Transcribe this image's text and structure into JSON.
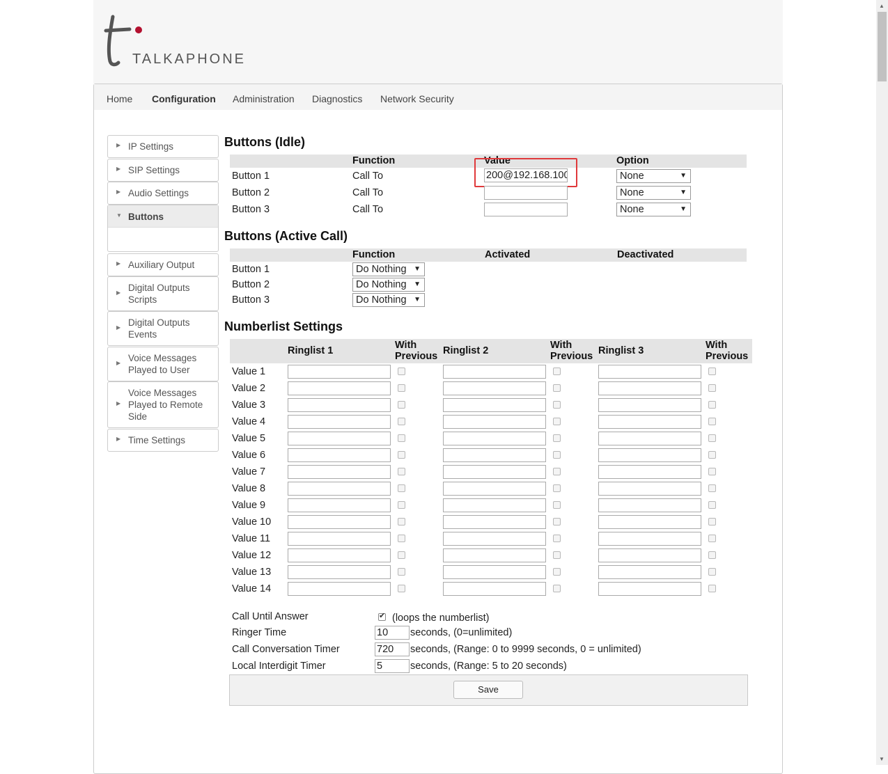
{
  "brand": {
    "name": "TALKAPHONE",
    "accent": "#b3102f"
  },
  "nav": [
    "Home",
    "Configuration",
    "Administration",
    "Diagnostics",
    "Network Security"
  ],
  "sidebar": [
    {
      "label": "IP Settings",
      "icon": "caret-right-icon"
    },
    {
      "label": "SIP Settings",
      "icon": "caret-right-icon"
    },
    {
      "label": "Audio Settings",
      "icon": "caret-right-icon"
    },
    {
      "label": "Buttons",
      "icon": "caret-down-icon",
      "expanded": true
    },
    {
      "label": "Auxiliary Output",
      "icon": "caret-right-icon"
    },
    {
      "label": "Digital Outputs Scripts",
      "icon": "caret-right-icon"
    },
    {
      "label": "Digital Outputs Events",
      "icon": "caret-right-icon"
    },
    {
      "label": "Voice Messages Played to User",
      "icon": "caret-right-icon"
    },
    {
      "label": "Voice Messages Played to Remote Side",
      "icon": "caret-right-icon"
    },
    {
      "label": "Time Settings",
      "icon": "caret-right-icon"
    }
  ],
  "idle": {
    "title": "Buttons (Idle)",
    "headers": [
      "Function",
      "Value",
      "Option"
    ],
    "rows": [
      {
        "label": "Button 1",
        "function": "Call To",
        "value": "200@192.168.100",
        "option": "None"
      },
      {
        "label": "Button 2",
        "function": "Call To",
        "value": "",
        "option": "None"
      },
      {
        "label": "Button 3",
        "function": "Call To",
        "value": "",
        "option": "None"
      }
    ]
  },
  "active": {
    "title": "Buttons (Active Call)",
    "headers": [
      "Function",
      "Activated",
      "Deactivated"
    ],
    "rows": [
      {
        "label": "Button 1",
        "function": "Do Nothing"
      },
      {
        "label": "Button 2",
        "function": "Do Nothing"
      },
      {
        "label": "Button 3",
        "function": "Do Nothing"
      }
    ]
  },
  "numberlist": {
    "title": "Numberlist Settings",
    "headers": [
      "Ringlist 1",
      "With Previous",
      "Ringlist 2",
      "With Previous",
      "Ringlist 3",
      "With Previous"
    ],
    "rows": [
      "Value 1",
      "Value 2",
      "Value 3",
      "Value 4",
      "Value 5",
      "Value 6",
      "Value 7",
      "Value 8",
      "Value 9",
      "Value 10",
      "Value 11",
      "Value 12",
      "Value 13",
      "Value 14"
    ]
  },
  "settings": {
    "call_until_answer": {
      "label": "Call Until Answer",
      "checked": true,
      "note": "(loops the numberlist)"
    },
    "ringer_time": {
      "label": "Ringer Time",
      "value": "10",
      "note": "seconds, (0=unlimited)"
    },
    "conversation_timer": {
      "label": "Call Conversation Timer",
      "value": "720",
      "note": "seconds, (Range: 0 to 9999 seconds, 0 = unlimited)"
    },
    "interdigit_timer": {
      "label": "Local Interdigit Timer",
      "value": "5",
      "note": "seconds, (Range: 5 to 20 seconds)"
    }
  },
  "save_label": "Save",
  "colors": {
    "highlight": "#e0393b",
    "header_bar": "#e4e4e4"
  }
}
